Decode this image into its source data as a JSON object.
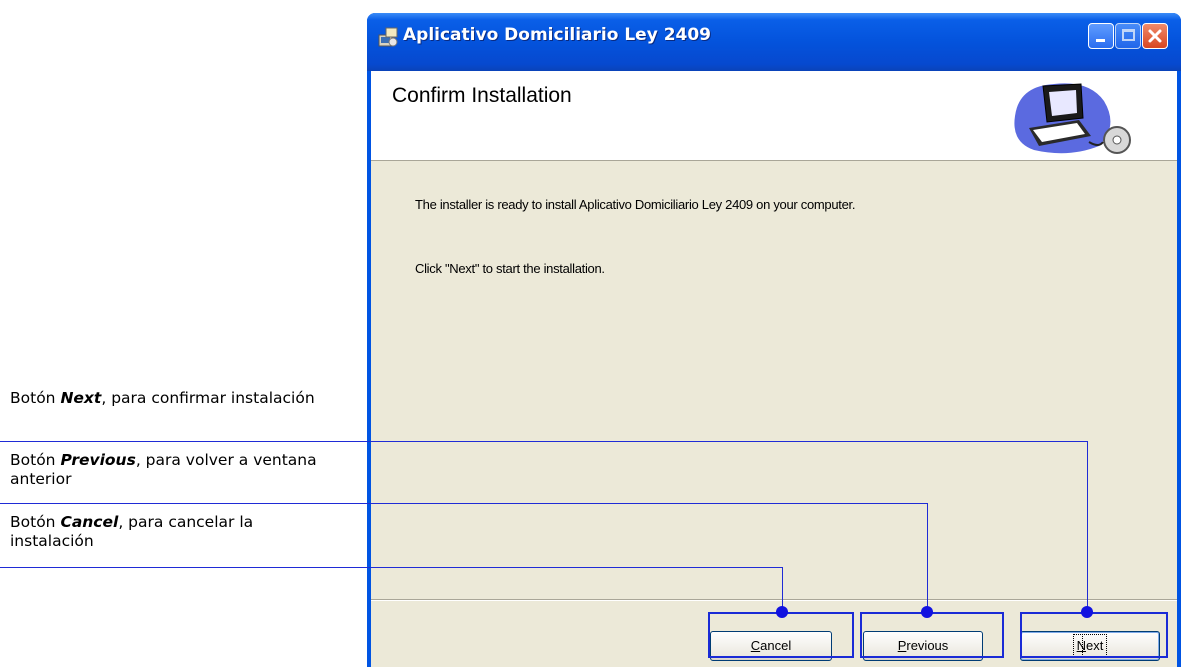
{
  "window": {
    "title": "Aplicativo Domiciliario Ley 2409"
  },
  "banner": {
    "title": "Confirm Installation",
    "art_icon": "computer-cd-icon"
  },
  "body": {
    "line1": "The installer is ready to install Aplicativo Domiciliario Ley 2409 on your computer.",
    "line2": "Click \"Next\" to start the installation."
  },
  "buttons": {
    "cancel": {
      "mnemonic": "C",
      "rest": "ancel"
    },
    "previous": {
      "mnemonic": "P",
      "rest": "revious"
    },
    "next": {
      "mnemonic": "N",
      "rest": "ext"
    }
  },
  "annotations": [
    {
      "prefix": "Botón ",
      "bold": "Next",
      "suffix": ", para confirmar instalación"
    },
    {
      "prefix": "Botón ",
      "bold": "Previous",
      "suffix": ", para volver a ventana anterior"
    },
    {
      "prefix": "Botón ",
      "bold": "Cancel",
      "suffix": ", para cancelar la instalación"
    }
  ],
  "colors": {
    "annotation_line": "#1f2bd6",
    "titlebar": "#0453dc",
    "dialog_bg": "#ece9d8"
  }
}
